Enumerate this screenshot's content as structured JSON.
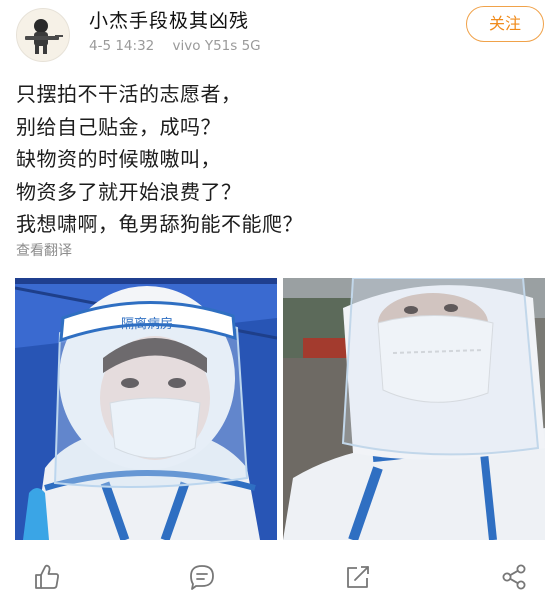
{
  "post": {
    "username": "小杰手段极其凶残",
    "date": "4-5 14:32",
    "device": "vivo Y51s 5G",
    "follow_label": "关注",
    "text_lines": [
      "只摆拍不干活的志愿者，",
      "别给自己贴金，成吗？",
      "缺物资的时候嗷嗷叫，",
      "物资多了就开始浪费了？",
      "我想啸啊，龟男舔狗能不能爬？"
    ],
    "translate_label": "查看翻译"
  },
  "photo_1": {
    "shield_label": "隔离病房"
  },
  "icons": {
    "like": "thumb-up-icon",
    "comment": "comment-icon",
    "share": "share-edit-icon",
    "more": "more-share-icon"
  },
  "colors": {
    "accent": "#f08b1b",
    "meta_text": "#9a9a9a",
    "icon_gray": "#777777"
  }
}
